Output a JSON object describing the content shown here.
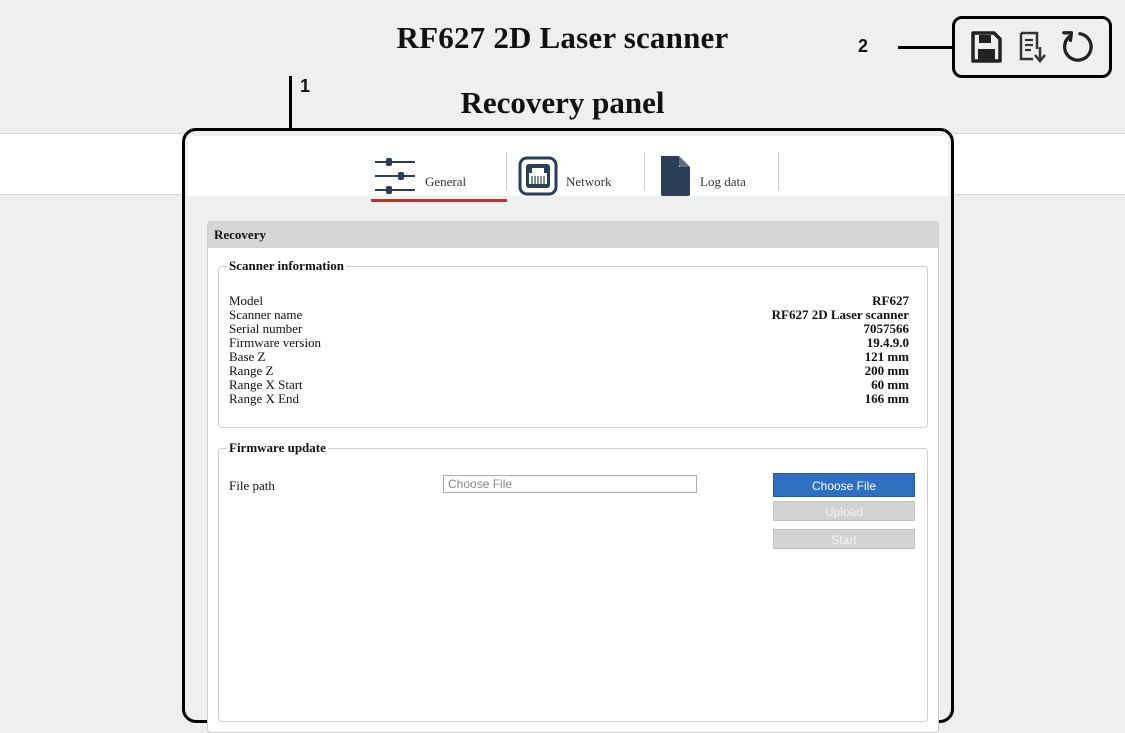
{
  "header": {
    "title": "RF627 2D Laser scanner",
    "subtitle": "Recovery panel"
  },
  "callouts": {
    "one": "1",
    "two": "2"
  },
  "toolbar": {
    "icons": [
      "save-icon",
      "save-log-icon",
      "reboot-icon"
    ]
  },
  "tabs": [
    {
      "label": "General",
      "icon": "sliders-icon",
      "active": true
    },
    {
      "label": "Network",
      "icon": "ethernet-port-icon",
      "active": false
    },
    {
      "label": "Log data",
      "icon": "document-icon",
      "active": false
    }
  ],
  "recovery": {
    "header": "Recovery",
    "scanner_info": {
      "legend": "Scanner information",
      "rows": [
        {
          "key": "Model",
          "value": "RF627"
        },
        {
          "key": "Scanner name",
          "value": "RF627 2D Laser scanner"
        },
        {
          "key": "Serial number",
          "value": "7057566"
        },
        {
          "key": "Firmware version",
          "value": "19.4.9.0"
        },
        {
          "key": "Base Z",
          "value": "121 mm"
        },
        {
          "key": "Range Z",
          "value": "200 mm"
        },
        {
          "key": "Range X Start",
          "value": "60 mm"
        },
        {
          "key": "Range X End",
          "value": "166 mm"
        }
      ]
    },
    "firmware_update": {
      "legend": "Firmware update",
      "file_path_label": "File path",
      "file_placeholder": "Choose File",
      "choose_button": "Choose File",
      "upload_button": "Upload",
      "start_button": "Start"
    }
  },
  "colors": {
    "accent_underline": "#e2231a",
    "primary_button": "#2e6fbf",
    "tab_icon": "#2a3f55"
  }
}
